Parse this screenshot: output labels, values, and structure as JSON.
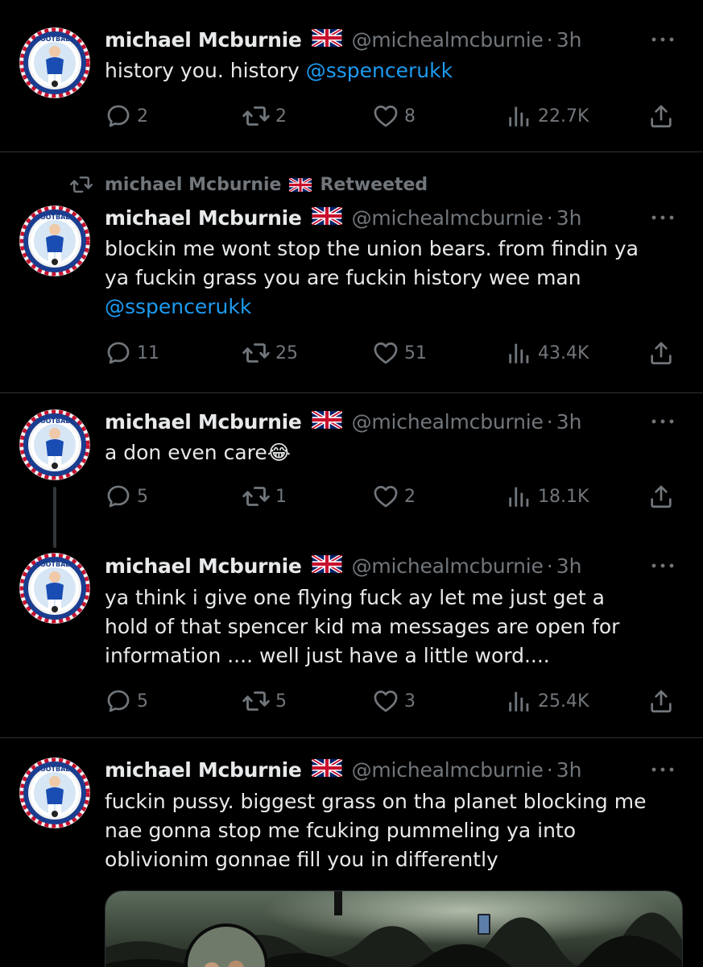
{
  "colors": {
    "background": "#000000",
    "text": "#e7e9ea",
    "muted": "#71767b",
    "link": "#1d9bf0",
    "divider": "#2f3336"
  },
  "retweet_label": {
    "icon": "retweet-icon",
    "name": "michael Mcburnie",
    "flag": "uk-flag-emoji",
    "text": "Retweeted"
  },
  "tweets": [
    {
      "name": "michael Mcburnie",
      "flag": "uk-flag-emoji",
      "handle": "@michealmcburnie",
      "separator": "·",
      "time": "3h",
      "text": "history you. history ",
      "mention": "@sspencerukk",
      "replies": "2",
      "retweets": "2",
      "likes": "8",
      "views": "22.7K"
    },
    {
      "name": "michael Mcburnie",
      "flag": "uk-flag-emoji",
      "handle": "@michealmcburnie",
      "separator": "·",
      "time": "3h",
      "text_line1": "blockin me wont stop the union bears. from findin ya",
      "text_line2": "ya fuckin grass you are fuckin history wee man",
      "mention": "@sspencerukk",
      "replies": "11",
      "retweets": "25",
      "likes": "51",
      "views": "43.4K"
    },
    {
      "name": "michael Mcburnie",
      "flag": "uk-flag-emoji",
      "handle": "@michealmcburnie",
      "separator": "·",
      "time": "3h",
      "text": "a don even care",
      "emoji": "😂",
      "replies": "5",
      "retweets": "1",
      "likes": "2",
      "views": "18.1K"
    },
    {
      "name": "michael Mcburnie",
      "flag": "uk-flag-emoji",
      "handle": "@michealmcburnie",
      "separator": "·",
      "time": "3h",
      "text_line1": "ya think i give one flying fuck ay let me just get a",
      "text_line2": "hold of that spencer kid ma messages are open for",
      "text_line3": "information .... well just have a little word....",
      "replies": "5",
      "retweets": "5",
      "likes": "3",
      "views": "25.4K"
    },
    {
      "name": "michael Mcburnie",
      "flag": "uk-flag-emoji",
      "handle": "@michealmcburnie",
      "separator": "·",
      "time": "3h",
      "text_line1": "fuckin pussy. biggest grass on tha planet blocking me",
      "text_line2": "nae gonna stop me fcuking pummeling ya into",
      "text_line3": "oblivionim gonnae fill you in differently"
    }
  ]
}
